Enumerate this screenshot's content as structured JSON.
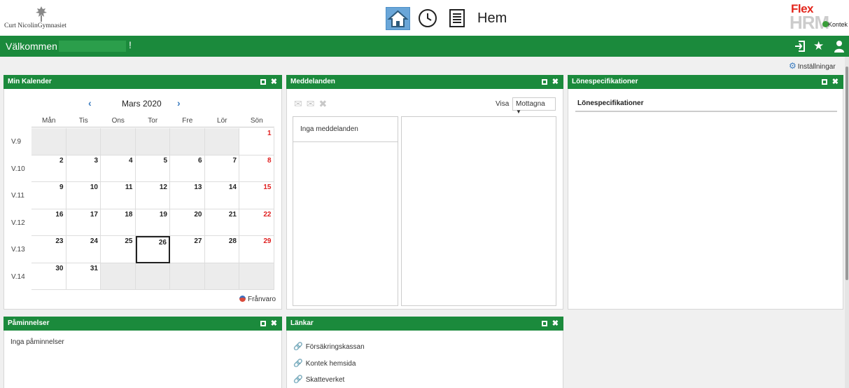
{
  "header": {
    "org_name": "Curt NicolinGymnasiet",
    "title": "Hem",
    "brand_flex": "Flex",
    "brand_hrm": "HRM",
    "brand_kontek": "Kontek"
  },
  "welcome": {
    "greeting": "Välkommen",
    "exclamation": "!"
  },
  "settings_label": "Inställningar",
  "calendar": {
    "title": "Min Kalender",
    "month": "Mars 2020",
    "prev": "‹",
    "next": "›",
    "weekdays": [
      "Mån",
      "Tis",
      "Ons",
      "Tor",
      "Fre",
      "Lör",
      "Sön"
    ],
    "weeks": [
      {
        "label": "V.9",
        "days": [
          "",
          "",
          "",
          "",
          "",
          "",
          "1"
        ]
      },
      {
        "label": "V.10",
        "days": [
          "2",
          "3",
          "4",
          "5",
          "6",
          "7",
          "8"
        ]
      },
      {
        "label": "V.11",
        "days": [
          "9",
          "10",
          "11",
          "12",
          "13",
          "14",
          "15"
        ]
      },
      {
        "label": "V.12",
        "days": [
          "16",
          "17",
          "18",
          "19",
          "20",
          "21",
          "22"
        ]
      },
      {
        "label": "V.13",
        "days": [
          "23",
          "24",
          "25",
          "26",
          "27",
          "28",
          "29"
        ]
      },
      {
        "label": "V.14",
        "days": [
          "30",
          "31",
          "",
          "",
          "",
          "",
          ""
        ]
      }
    ],
    "today": "26",
    "absence_label": "Frånvaro"
  },
  "messages": {
    "title": "Meddelanden",
    "visa_label": "Visa",
    "filter_value": "Mottagna",
    "empty_text": "Inga meddelanden"
  },
  "payslips": {
    "title": "Lönespecifikationer",
    "column_header": "Lönespecifikationer"
  },
  "reminders": {
    "title": "Påminnelser",
    "empty_text": "Inga påminnelser"
  },
  "links": {
    "title": "Länkar",
    "items": [
      "Försäkringskassan",
      "Kontek hemsida",
      "Skatteverket"
    ]
  },
  "colors": {
    "brand_green": "#1b8a3c",
    "link_blue": "#3a7bbf",
    "sunday_red": "#e02020",
    "home_active": "#6aa6d8"
  }
}
